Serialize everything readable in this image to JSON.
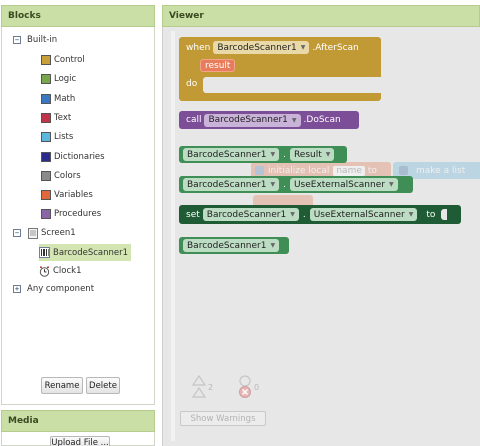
{
  "blocks_panel": {
    "title": "Blocks",
    "builtin_label": "Built-in",
    "builtin_items": [
      {
        "label": "Control",
        "color": "#c7a03a"
      },
      {
        "label": "Logic",
        "color": "#78a64a"
      },
      {
        "label": "Math",
        "color": "#3b77c2"
      },
      {
        "label": "Text",
        "color": "#c2334b"
      },
      {
        "label": "Lists",
        "color": "#5bb7dd"
      },
      {
        "label": "Dictionaries",
        "color": "#2b2b8f"
      },
      {
        "label": "Colors",
        "color": "#8a8a8a"
      },
      {
        "label": "Variables",
        "color": "#e0683b"
      },
      {
        "label": "Procedures",
        "color": "#8a65a8"
      }
    ],
    "screen_label": "Screen1",
    "components": [
      "BarcodeScanner1",
      "Clock1"
    ],
    "any_component_label": "Any component",
    "rename_label": "Rename",
    "delete_label": "Delete"
  },
  "media_panel": {
    "title": "Media",
    "upload_label": "Upload File ..."
  },
  "viewer": {
    "title": "Viewer",
    "event_block": {
      "when": "when",
      "component": "BarcodeScanner1",
      "event": ".AfterScan",
      "param": "result",
      "do": "do"
    },
    "call_block": {
      "call": "call",
      "component": "BarcodeScanner1",
      "method": ".DoScan"
    },
    "getter_result": {
      "component": "BarcodeScanner1",
      "dot": ".",
      "property": "Result"
    },
    "getter_external": {
      "component": "BarcodeScanner1",
      "dot": ".",
      "property": "UseExternalScanner"
    },
    "setter_block": {
      "set": "set",
      "component": "BarcodeScanner1",
      "dot": ".",
      "property": "UseExternalScanner",
      "to": "to"
    },
    "component_block": {
      "component": "BarcodeScanner1"
    },
    "ghost_init": {
      "label": "initialize local",
      "name": "name",
      "to": "to"
    },
    "ghost_list": {
      "label": "make a list"
    },
    "warnings_count": "2",
    "errors_count": "0",
    "show_warnings_label": "Show Warnings"
  }
}
